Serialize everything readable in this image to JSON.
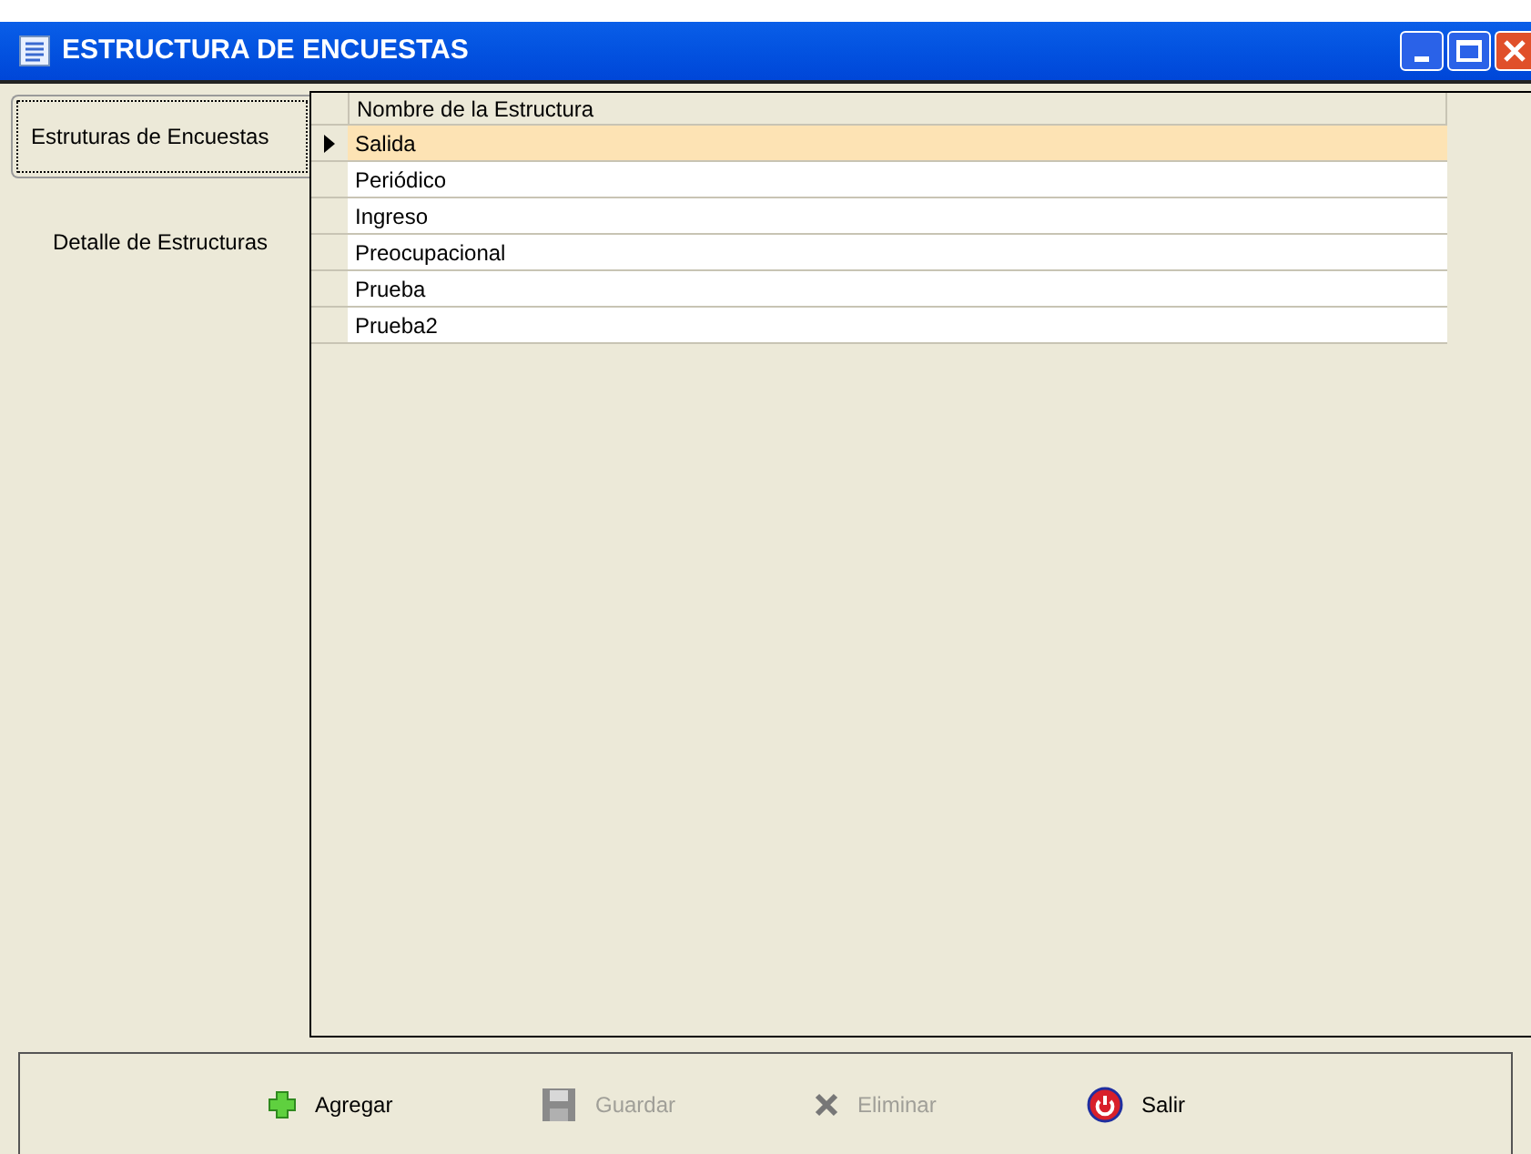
{
  "window": {
    "title": "ESTRUCTURA DE ENCUESTAS"
  },
  "tabs": [
    {
      "label": "Estruturas de Encuestas",
      "selected": true
    },
    {
      "label": "Detalle de Estructuras",
      "selected": false
    }
  ],
  "table": {
    "columns": [
      "Nombre de la Estructura"
    ],
    "rows": [
      {
        "cells": [
          "Salida"
        ],
        "selected": true
      },
      {
        "cells": [
          "Periódico"
        ],
        "selected": false
      },
      {
        "cells": [
          "Ingreso"
        ],
        "selected": false
      },
      {
        "cells": [
          "Preocupacional"
        ],
        "selected": false
      },
      {
        "cells": [
          "Prueba"
        ],
        "selected": false
      },
      {
        "cells": [
          "Prueba2"
        ],
        "selected": false
      }
    ]
  },
  "buttons": [
    {
      "kind": "add",
      "label": "Agregar",
      "disabled": false
    },
    {
      "kind": "save",
      "label": "Guardar",
      "disabled": true
    },
    {
      "kind": "delete",
      "label": "Eliminar",
      "disabled": true
    },
    {
      "kind": "exit",
      "label": "Salir",
      "disabled": false
    }
  ]
}
